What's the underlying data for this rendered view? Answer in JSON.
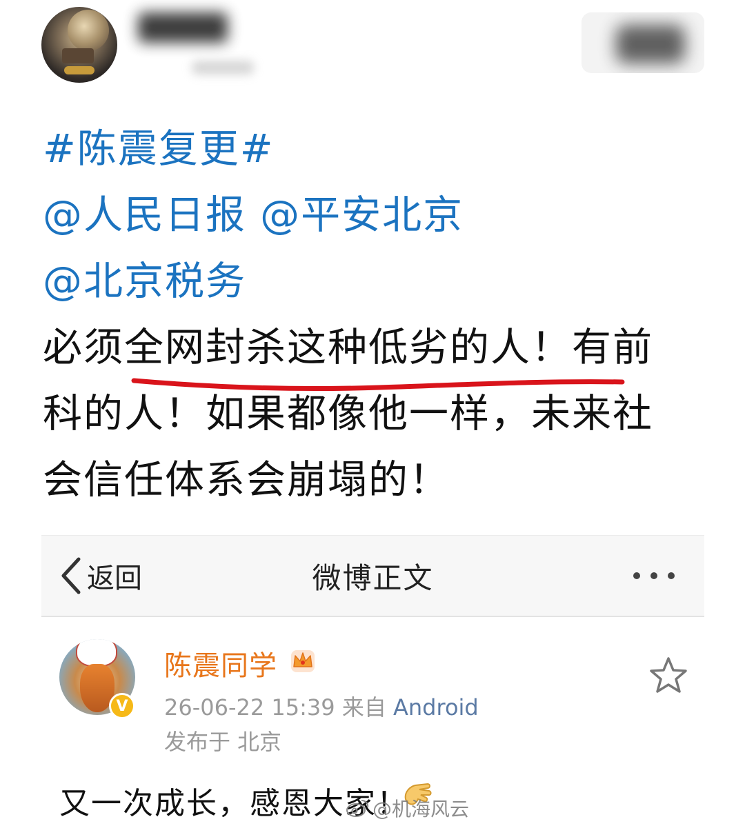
{
  "post": {
    "hashtag": "#陈震复更#",
    "mentions_line1": "@人民日报 @平安北京",
    "mentions_line2": "@北京税务",
    "body_line1": "必须全网封杀这种低劣的人！有前",
    "body_line2": "科的人！如果都像他一样，未来社",
    "body_line3": "会信任体系会崩塌的！",
    "highlight_color": "#d9141b",
    "link_color": "#1b73c0"
  },
  "screenshot": {
    "nav": {
      "back_label": "返回",
      "title": "微博正文"
    },
    "author": {
      "name": "陈震同学",
      "verify_mark": "V",
      "name_color": "#e8761b"
    },
    "meta": {
      "datetime": "26-06-22 15:39",
      "source_prefix": "来自",
      "source": "Android",
      "location_prefix": "发布于",
      "location": "北京"
    },
    "content": "又一次成长，感恩大家！"
  },
  "watermark": {
    "text": "@机海风云"
  },
  "icons": [
    "back-chevron-icon",
    "more-icon",
    "crown-icon",
    "star-icon",
    "clap-icon",
    "weibo-logo-icon"
  ]
}
